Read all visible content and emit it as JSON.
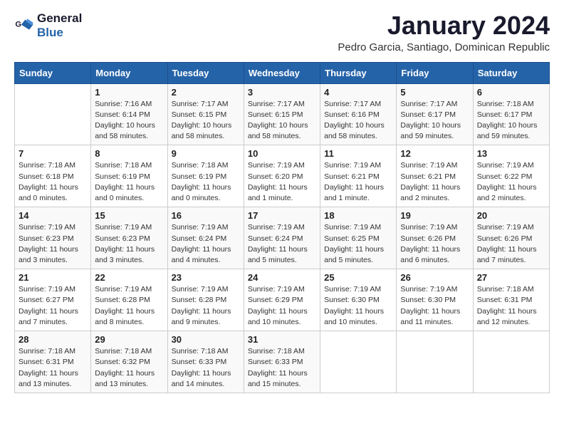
{
  "logo": {
    "line1": "General",
    "line2": "Blue"
  },
  "title": "January 2024",
  "location": "Pedro Garcia, Santiago, Dominican Republic",
  "header_days": [
    "Sunday",
    "Monday",
    "Tuesday",
    "Wednesday",
    "Thursday",
    "Friday",
    "Saturday"
  ],
  "weeks": [
    [
      {
        "day": "",
        "info": ""
      },
      {
        "day": "1",
        "info": "Sunrise: 7:16 AM\nSunset: 6:14 PM\nDaylight: 10 hours\nand 58 minutes."
      },
      {
        "day": "2",
        "info": "Sunrise: 7:17 AM\nSunset: 6:15 PM\nDaylight: 10 hours\nand 58 minutes."
      },
      {
        "day": "3",
        "info": "Sunrise: 7:17 AM\nSunset: 6:15 PM\nDaylight: 10 hours\nand 58 minutes."
      },
      {
        "day": "4",
        "info": "Sunrise: 7:17 AM\nSunset: 6:16 PM\nDaylight: 10 hours\nand 58 minutes."
      },
      {
        "day": "5",
        "info": "Sunrise: 7:17 AM\nSunset: 6:17 PM\nDaylight: 10 hours\nand 59 minutes."
      },
      {
        "day": "6",
        "info": "Sunrise: 7:18 AM\nSunset: 6:17 PM\nDaylight: 10 hours\nand 59 minutes."
      }
    ],
    [
      {
        "day": "7",
        "info": "Sunrise: 7:18 AM\nSunset: 6:18 PM\nDaylight: 11 hours\nand 0 minutes."
      },
      {
        "day": "8",
        "info": "Sunrise: 7:18 AM\nSunset: 6:19 PM\nDaylight: 11 hours\nand 0 minutes."
      },
      {
        "day": "9",
        "info": "Sunrise: 7:18 AM\nSunset: 6:19 PM\nDaylight: 11 hours\nand 0 minutes."
      },
      {
        "day": "10",
        "info": "Sunrise: 7:19 AM\nSunset: 6:20 PM\nDaylight: 11 hours\nand 1 minute."
      },
      {
        "day": "11",
        "info": "Sunrise: 7:19 AM\nSunset: 6:21 PM\nDaylight: 11 hours\nand 1 minute."
      },
      {
        "day": "12",
        "info": "Sunrise: 7:19 AM\nSunset: 6:21 PM\nDaylight: 11 hours\nand 2 minutes."
      },
      {
        "day": "13",
        "info": "Sunrise: 7:19 AM\nSunset: 6:22 PM\nDaylight: 11 hours\nand 2 minutes."
      }
    ],
    [
      {
        "day": "14",
        "info": "Sunrise: 7:19 AM\nSunset: 6:23 PM\nDaylight: 11 hours\nand 3 minutes."
      },
      {
        "day": "15",
        "info": "Sunrise: 7:19 AM\nSunset: 6:23 PM\nDaylight: 11 hours\nand 3 minutes."
      },
      {
        "day": "16",
        "info": "Sunrise: 7:19 AM\nSunset: 6:24 PM\nDaylight: 11 hours\nand 4 minutes."
      },
      {
        "day": "17",
        "info": "Sunrise: 7:19 AM\nSunset: 6:24 PM\nDaylight: 11 hours\nand 5 minutes."
      },
      {
        "day": "18",
        "info": "Sunrise: 7:19 AM\nSunset: 6:25 PM\nDaylight: 11 hours\nand 5 minutes."
      },
      {
        "day": "19",
        "info": "Sunrise: 7:19 AM\nSunset: 6:26 PM\nDaylight: 11 hours\nand 6 minutes."
      },
      {
        "day": "20",
        "info": "Sunrise: 7:19 AM\nSunset: 6:26 PM\nDaylight: 11 hours\nand 7 minutes."
      }
    ],
    [
      {
        "day": "21",
        "info": "Sunrise: 7:19 AM\nSunset: 6:27 PM\nDaylight: 11 hours\nand 7 minutes."
      },
      {
        "day": "22",
        "info": "Sunrise: 7:19 AM\nSunset: 6:28 PM\nDaylight: 11 hours\nand 8 minutes."
      },
      {
        "day": "23",
        "info": "Sunrise: 7:19 AM\nSunset: 6:28 PM\nDaylight: 11 hours\nand 9 minutes."
      },
      {
        "day": "24",
        "info": "Sunrise: 7:19 AM\nSunset: 6:29 PM\nDaylight: 11 hours\nand 10 minutes."
      },
      {
        "day": "25",
        "info": "Sunrise: 7:19 AM\nSunset: 6:30 PM\nDaylight: 11 hours\nand 10 minutes."
      },
      {
        "day": "26",
        "info": "Sunrise: 7:19 AM\nSunset: 6:30 PM\nDaylight: 11 hours\nand 11 minutes."
      },
      {
        "day": "27",
        "info": "Sunrise: 7:18 AM\nSunset: 6:31 PM\nDaylight: 11 hours\nand 12 minutes."
      }
    ],
    [
      {
        "day": "28",
        "info": "Sunrise: 7:18 AM\nSunset: 6:31 PM\nDaylight: 11 hours\nand 13 minutes."
      },
      {
        "day": "29",
        "info": "Sunrise: 7:18 AM\nSunset: 6:32 PM\nDaylight: 11 hours\nand 13 minutes."
      },
      {
        "day": "30",
        "info": "Sunrise: 7:18 AM\nSunset: 6:33 PM\nDaylight: 11 hours\nand 14 minutes."
      },
      {
        "day": "31",
        "info": "Sunrise: 7:18 AM\nSunset: 6:33 PM\nDaylight: 11 hours\nand 15 minutes."
      },
      {
        "day": "",
        "info": ""
      },
      {
        "day": "",
        "info": ""
      },
      {
        "day": "",
        "info": ""
      }
    ]
  ]
}
